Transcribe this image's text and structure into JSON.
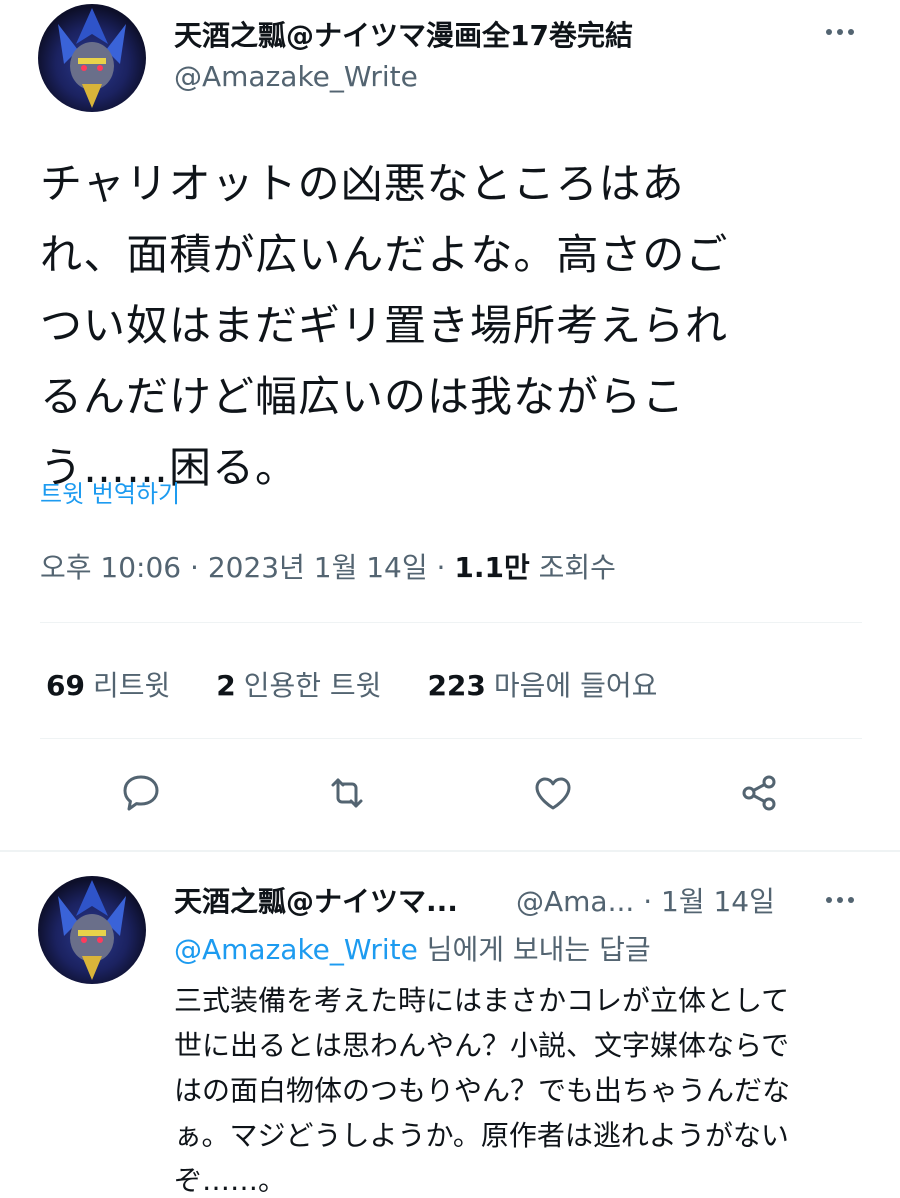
{
  "tweet": {
    "author_name": "天酒之瓢@ナイツマ漫画全17巻完結",
    "author_handle": "@Amazake_Write",
    "text_lines": [
      "チャリオットの凶悪なところはあ",
      "れ、面積が広いんだよな。高さのご",
      "つい奴はまだギリ置き場所考えられ",
      "るんだけど幅広いのは我ながらこ",
      "う……困る。"
    ],
    "translate_label": "트윗 번역하기",
    "time": "오후 10:06",
    "date": "2023년 1월 14일",
    "views_count": "1.1만",
    "views_label": "조회수",
    "stats": {
      "retweets": {
        "count": "69",
        "label": "리트윗"
      },
      "quotes": {
        "count": "2",
        "label": "인용한 트윗"
      },
      "likes": {
        "count": "223",
        "label": "마음에 들어요"
      }
    }
  },
  "icons": {
    "reply": "reply-bubble-icon",
    "retweet": "retweet-icon",
    "like": "heart-icon",
    "share": "share-icon",
    "more": "more-dots-icon"
  },
  "reply": {
    "author_name": "天酒之瓢@ナイツマ...",
    "author_handle": "@Ama...",
    "separator": "·",
    "date": "1월 14일",
    "reply_to_handle": "@Amazake_Write",
    "reply_to_suffix": "님에게 보내는 답글",
    "text_lines": [
      "三式装備を考えた時にはまさかコレが立体として",
      "世に出るとは思わんやん？小説、文字媒体ならで",
      "はの面白物体のつもりやん？でも出ちゃうんだな",
      "ぁ。マジどうしようか。原作者は逃れようがない",
      "ぞ……。"
    ]
  },
  "colors": {
    "text": "#0f1419",
    "secondary": "#536471",
    "link": "#1d9bf0",
    "divider": "#eff3f4"
  }
}
